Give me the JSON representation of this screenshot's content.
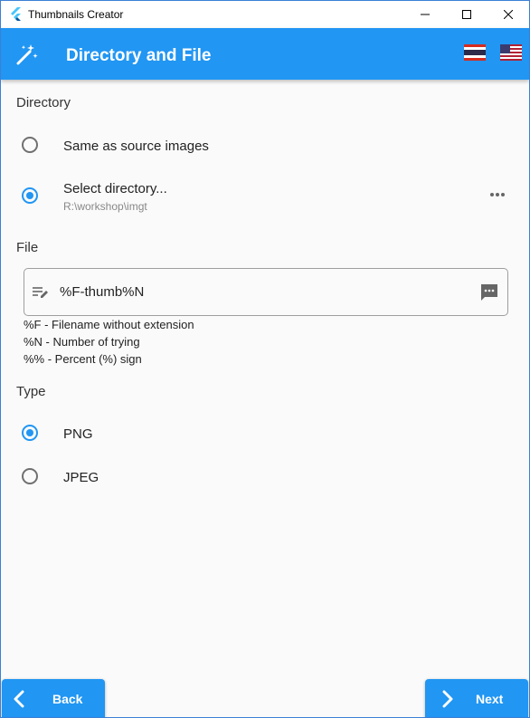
{
  "window": {
    "title": "Thumbnails Creator",
    "icon": "flutter-logo-icon",
    "controls": [
      "minimize-icon",
      "maximize-icon",
      "close-icon"
    ]
  },
  "appbar": {
    "title": "Directory and File",
    "icon": "magic-wand-icon",
    "background": "#2196f3",
    "flags": [
      "thailand-flag-icon",
      "us-flag-icon"
    ]
  },
  "directory": {
    "label": "Directory",
    "options": [
      {
        "label": "Same as source images",
        "selected": false
      },
      {
        "label": "Select directory...",
        "subtitle": "R:\\workshop\\imgt",
        "selected": true
      }
    ]
  },
  "file": {
    "label": "File",
    "value": "%F-thumb%N",
    "help": [
      "%F - Filename without extension",
      "%N - Number of trying",
      "%% - Percent (%) sign"
    ]
  },
  "type": {
    "label": "Type",
    "options": [
      {
        "label": "PNG",
        "selected": true
      },
      {
        "label": "JPEG",
        "selected": false
      }
    ]
  },
  "footer": {
    "back_label": "Back",
    "next_label": "Next"
  }
}
